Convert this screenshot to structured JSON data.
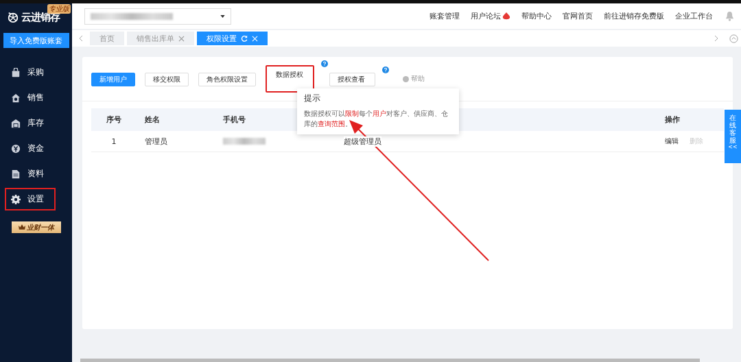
{
  "sidebar": {
    "logo": "云进销存",
    "edition_badge": "专业版",
    "import_button": "导入免费版账套",
    "items": [
      {
        "label": "采购",
        "highlighted": false
      },
      {
        "label": "销售",
        "highlighted": false
      },
      {
        "label": "库存",
        "highlighted": false
      },
      {
        "label": "资金",
        "highlighted": false
      },
      {
        "label": "资料",
        "highlighted": false
      },
      {
        "label": "设置",
        "highlighted": true
      }
    ],
    "promo_button": "业财一体"
  },
  "top_nav": {
    "links": [
      {
        "label": "账套管理",
        "hot": false
      },
      {
        "label": "用户论坛",
        "hot": true
      },
      {
        "label": "帮助中心",
        "hot": false
      },
      {
        "label": "官网首页",
        "hot": false
      },
      {
        "label": "前往进销存免费版",
        "hot": false
      },
      {
        "label": "企业工作台",
        "hot": false
      }
    ]
  },
  "tabs": [
    {
      "label": "首页",
      "closable": false,
      "refresh": false,
      "selected": false
    },
    {
      "label": "销售出库单",
      "closable": true,
      "refresh": false,
      "selected": false
    },
    {
      "label": "权限设置",
      "closable": true,
      "refresh": true,
      "selected": true
    }
  ],
  "toolbar": {
    "buttons": [
      {
        "label": "新增用户",
        "kind": "primary",
        "help": false,
        "highlighted": false
      },
      {
        "label": "移交权限",
        "kind": "default",
        "help": false,
        "highlighted": false
      },
      {
        "label": "角色权限设置",
        "kind": "default",
        "help": false,
        "highlighted": false
      },
      {
        "label": "数据授权",
        "kind": "default",
        "help": true,
        "highlighted": true
      },
      {
        "label": "授权查看",
        "kind": "default",
        "help": true,
        "highlighted": false
      },
      {
        "label": "帮助",
        "kind": "link"
      }
    ]
  },
  "tooltip": {
    "title": "提示",
    "segments": [
      {
        "text": "数据授权可以",
        "highlight": false
      },
      {
        "text": "限制",
        "highlight": true
      },
      {
        "text": "每个",
        "highlight": false
      },
      {
        "text": "用户",
        "highlight": true
      },
      {
        "text": "对客户、供应商、仓库的",
        "highlight": false
      },
      {
        "text": "查询范围",
        "highlight": true
      },
      {
        "text": "。",
        "highlight": false
      }
    ]
  },
  "table": {
    "columns": [
      "序号",
      "姓名",
      "手机号",
      "",
      "操作"
    ],
    "rows": [
      {
        "index": "1",
        "name": "管理员",
        "role": "超级管理员",
        "actions": [
          {
            "label": "编辑",
            "disabled": false
          },
          {
            "label": "删除",
            "disabled": true
          }
        ]
      }
    ]
  },
  "online_service": {
    "label": "在线客服",
    "collapse": "<<"
  }
}
